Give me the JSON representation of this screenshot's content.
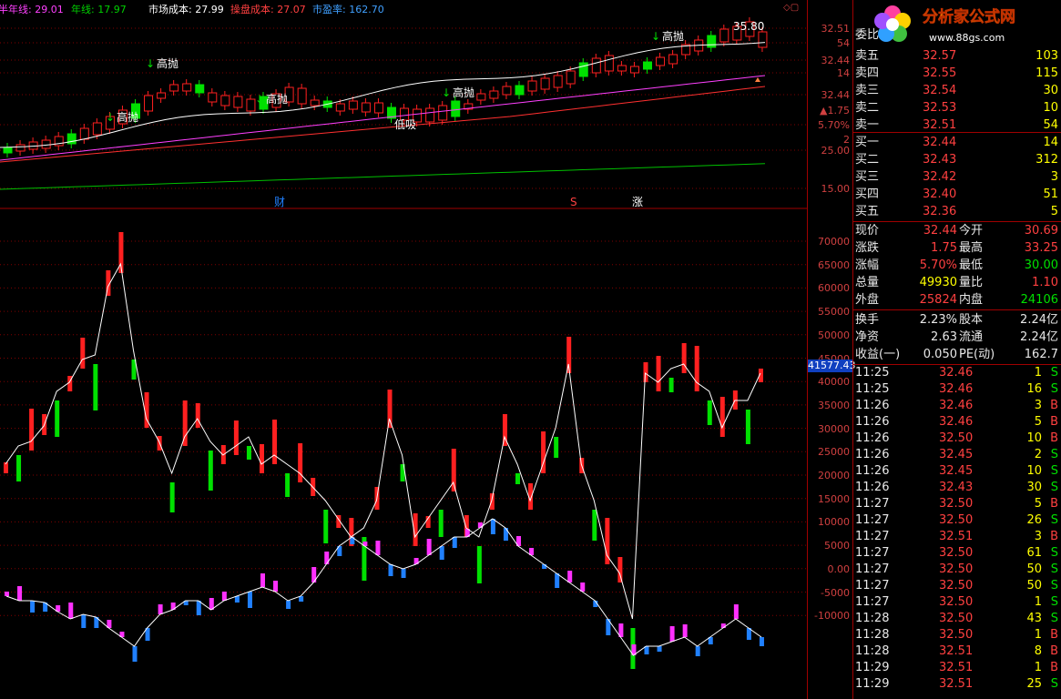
{
  "header": {
    "half_year": "半年线: 29.01",
    "year": "年线: 17.97",
    "market_cost": "市场成本: 27.99",
    "op_cost": "操盘成本: 27.07",
    "pe": "市盈率: 162.70"
  },
  "annotations": {
    "high": "高抛",
    "low": "低吸",
    "peak": "35.80"
  },
  "markers": [
    "财",
    "S",
    "涨"
  ],
  "axis_top": [
    "32.51",
    "54",
    "32.44",
    "14",
    "32.44",
    "▲1.75",
    "5.70%",
    "2",
    "25.00",
    "15.00"
  ],
  "axis_bottom": [
    "70000",
    "65000",
    "60000",
    "55000",
    "50000",
    "45000",
    "40000",
    "35000",
    "30000",
    "25000",
    "20000",
    "15000",
    "10000",
    "5000",
    "0.00",
    "-5000",
    "-10000"
  ],
  "cursor_value": "41577.43",
  "logo": {
    "title": "分析家公式网",
    "url": "www.88gs.com"
  },
  "orderbook": {
    "wb": "委比",
    "sell": [
      {
        "l": "卖五",
        "p": "32.57",
        "v": "103"
      },
      {
        "l": "卖四",
        "p": "32.55",
        "v": "115"
      },
      {
        "l": "卖三",
        "p": "32.54",
        "v": "30"
      },
      {
        "l": "卖二",
        "p": "32.53",
        "v": "10"
      },
      {
        "l": "卖一",
        "p": "32.51",
        "v": "54"
      }
    ],
    "buy": [
      {
        "l": "买一",
        "p": "32.44",
        "v": "14"
      },
      {
        "l": "买二",
        "p": "32.43",
        "v": "312"
      },
      {
        "l": "买三",
        "p": "32.42",
        "v": "3"
      },
      {
        "l": "买四",
        "p": "32.40",
        "v": "51"
      },
      {
        "l": "买五",
        "p": "32.36",
        "v": "5"
      }
    ]
  },
  "quote": [
    {
      "a": "现价",
      "av": "32.44",
      "b": "今开",
      "bv": "30.69"
    },
    {
      "a": "涨跌",
      "av": "1.75",
      "b": "最高",
      "bv": "33.25"
    },
    {
      "a": "涨幅",
      "av": "5.70%",
      "b": "最低",
      "bv": "30.00"
    },
    {
      "a": "总量",
      "av": "49930",
      "b": "量比",
      "bv": "1.10"
    },
    {
      "a": "外盘",
      "av": "25824",
      "b": "内盘",
      "bv": "24106"
    }
  ],
  "fund": [
    {
      "a": "换手",
      "av": "2.23%",
      "b": "股本",
      "bv": "2.24亿"
    },
    {
      "a": "净资",
      "av": "2.63",
      "b": "流通",
      "bv": "2.24亿"
    },
    {
      "a": "收益(一)",
      "av": "0.050",
      "b": "PE(动)",
      "bv": "162.7"
    }
  ],
  "ticks": [
    {
      "t": "11:25",
      "p": "32.46",
      "v": "1",
      "s": "S"
    },
    {
      "t": "11:25",
      "p": "32.46",
      "v": "16",
      "s": "S"
    },
    {
      "t": "11:26",
      "p": "32.46",
      "v": "3",
      "s": "B"
    },
    {
      "t": "11:26",
      "p": "32.46",
      "v": "5",
      "s": "B"
    },
    {
      "t": "11:26",
      "p": "32.50",
      "v": "10",
      "s": "B"
    },
    {
      "t": "11:26",
      "p": "32.45",
      "v": "2",
      "s": "S"
    },
    {
      "t": "11:26",
      "p": "32.45",
      "v": "10",
      "s": "S"
    },
    {
      "t": "11:26",
      "p": "32.43",
      "v": "30",
      "s": "S"
    },
    {
      "t": "11:27",
      "p": "32.50",
      "v": "5",
      "s": "B"
    },
    {
      "t": "11:27",
      "p": "32.50",
      "v": "26",
      "s": "S"
    },
    {
      "t": "11:27",
      "p": "32.51",
      "v": "3",
      "s": "B"
    },
    {
      "t": "11:27",
      "p": "32.50",
      "v": "61",
      "s": "S"
    },
    {
      "t": "11:27",
      "p": "32.50",
      "v": "50",
      "s": "S"
    },
    {
      "t": "11:27",
      "p": "32.50",
      "v": "50",
      "s": "S"
    },
    {
      "t": "11:27",
      "p": "32.50",
      "v": "1",
      "s": "S"
    },
    {
      "t": "11:28",
      "p": "32.50",
      "v": "43",
      "s": "S"
    },
    {
      "t": "11:28",
      "p": "32.50",
      "v": "1",
      "s": "B"
    },
    {
      "t": "11:28",
      "p": "32.51",
      "v": "8",
      "s": "B"
    },
    {
      "t": "11:29",
      "p": "32.51",
      "v": "1",
      "s": "B"
    },
    {
      "t": "11:29",
      "p": "32.51",
      "v": "25",
      "s": "S"
    }
  ],
  "colors": {
    "up": "#ff2020",
    "down": "#00e000",
    "ma1": "#ffffff",
    "ma2": "#ff40ff",
    "ma3": "#ff3030",
    "ma4": "#00c000",
    "blue": "#2080ff",
    "magenta": "#ff30ff",
    "grid": "#800000"
  }
}
